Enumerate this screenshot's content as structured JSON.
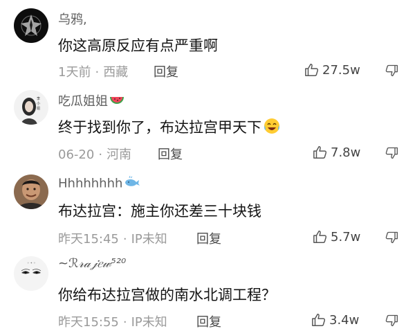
{
  "comments": [
    {
      "username": "乌鸦,",
      "text": "你这高原反应有点严重啊",
      "time": "1天前",
      "location": "西藏",
      "reply_label": "回复",
      "likes": "27.5w",
      "avatar_icon": "crow-emblem-icon"
    },
    {
      "username": "吃瓜姐姐",
      "username_emoji": "watermelon-icon",
      "text": "终于找到你了，布达拉宫甲天下",
      "text_emoji": "laughing-crying-face-icon",
      "time": "06-20",
      "location": "河南",
      "reply_label": "回复",
      "likes": "7.8w",
      "avatar_icon": "girl-portrait-icon"
    },
    {
      "username": "Hhhhhhhh",
      "username_emoji": "whale-icon",
      "text": "布达拉宫：施主你还差三十块钱",
      "time": "昨天15:45",
      "location": "IP未知",
      "reply_label": "回复",
      "likes": "5.7w",
      "avatar_icon": "man-portrait-icon"
    },
    {
      "username": "~ℛ𝓇𝒶𝒿𝑒𝓌⁵²⁰",
      "text": "你给布达拉宫做的南水北调工程？",
      "time": "昨天15:55",
      "location": "IP未知",
      "reply_label": "回复",
      "likes": "3.4w",
      "avatar_icon": "eyes-portrait-icon"
    }
  ],
  "colors": {
    "username": "#606060",
    "text": "#141414",
    "meta": "#9a9a9a",
    "reply": "#4a4a4a"
  },
  "icons": {
    "like": "thumbs-up-icon",
    "dislike": "thumbs-down-icon"
  }
}
